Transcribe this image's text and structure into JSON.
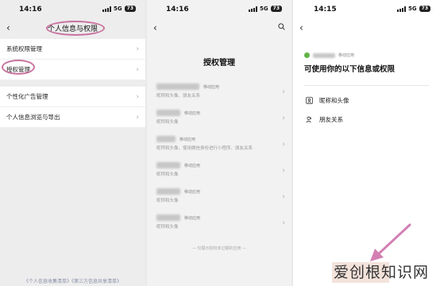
{
  "panel1": {
    "time": "14:16",
    "network": "5G",
    "battery": "73",
    "title": "个人信息与权限",
    "items": [
      {
        "label": "系统权限管理"
      },
      {
        "label": "授权管理"
      },
      {
        "label": "个性化广告管理"
      },
      {
        "label": "个人信息浏览与导出"
      }
    ],
    "footer": "《个人信息收集清单》《第三方信息共享清单》"
  },
  "panel2": {
    "time": "14:16",
    "network": "5G",
    "battery": "73",
    "title": "授权管理",
    "apps": [
      {
        "tag": "移动应用",
        "perms": "昵称和头像、朋友关系"
      },
      {
        "tag": "移动应用",
        "perms": "昵称和头像"
      },
      {
        "tag": "移动应用",
        "perms": "昵称和头像，使用微信身份进行小程序、朋友关系"
      },
      {
        "tag": "移动应用",
        "perms": "昵称和头像"
      },
      {
        "tag": "移动应用",
        "perms": "昵称和头像"
      },
      {
        "tag": "移动应用",
        "perms": "昵称和头像"
      }
    ],
    "bottom_note": "仅展示授权未过期的应用"
  },
  "panel3": {
    "time": "14:15",
    "network": "5G",
    "battery": "73",
    "app_tag": "移动应用",
    "title": "可使用你的以下信息或权限",
    "permissions": [
      {
        "label": "昵称和头像",
        "icon": "person-card-icon"
      },
      {
        "label": "朋友关系",
        "icon": "friends-icon"
      }
    ]
  },
  "watermark": "爱创根知识网",
  "colors": {
    "highlight": "#c9739f",
    "accent_green": "#60b347",
    "arrow": "#d37fb4"
  }
}
